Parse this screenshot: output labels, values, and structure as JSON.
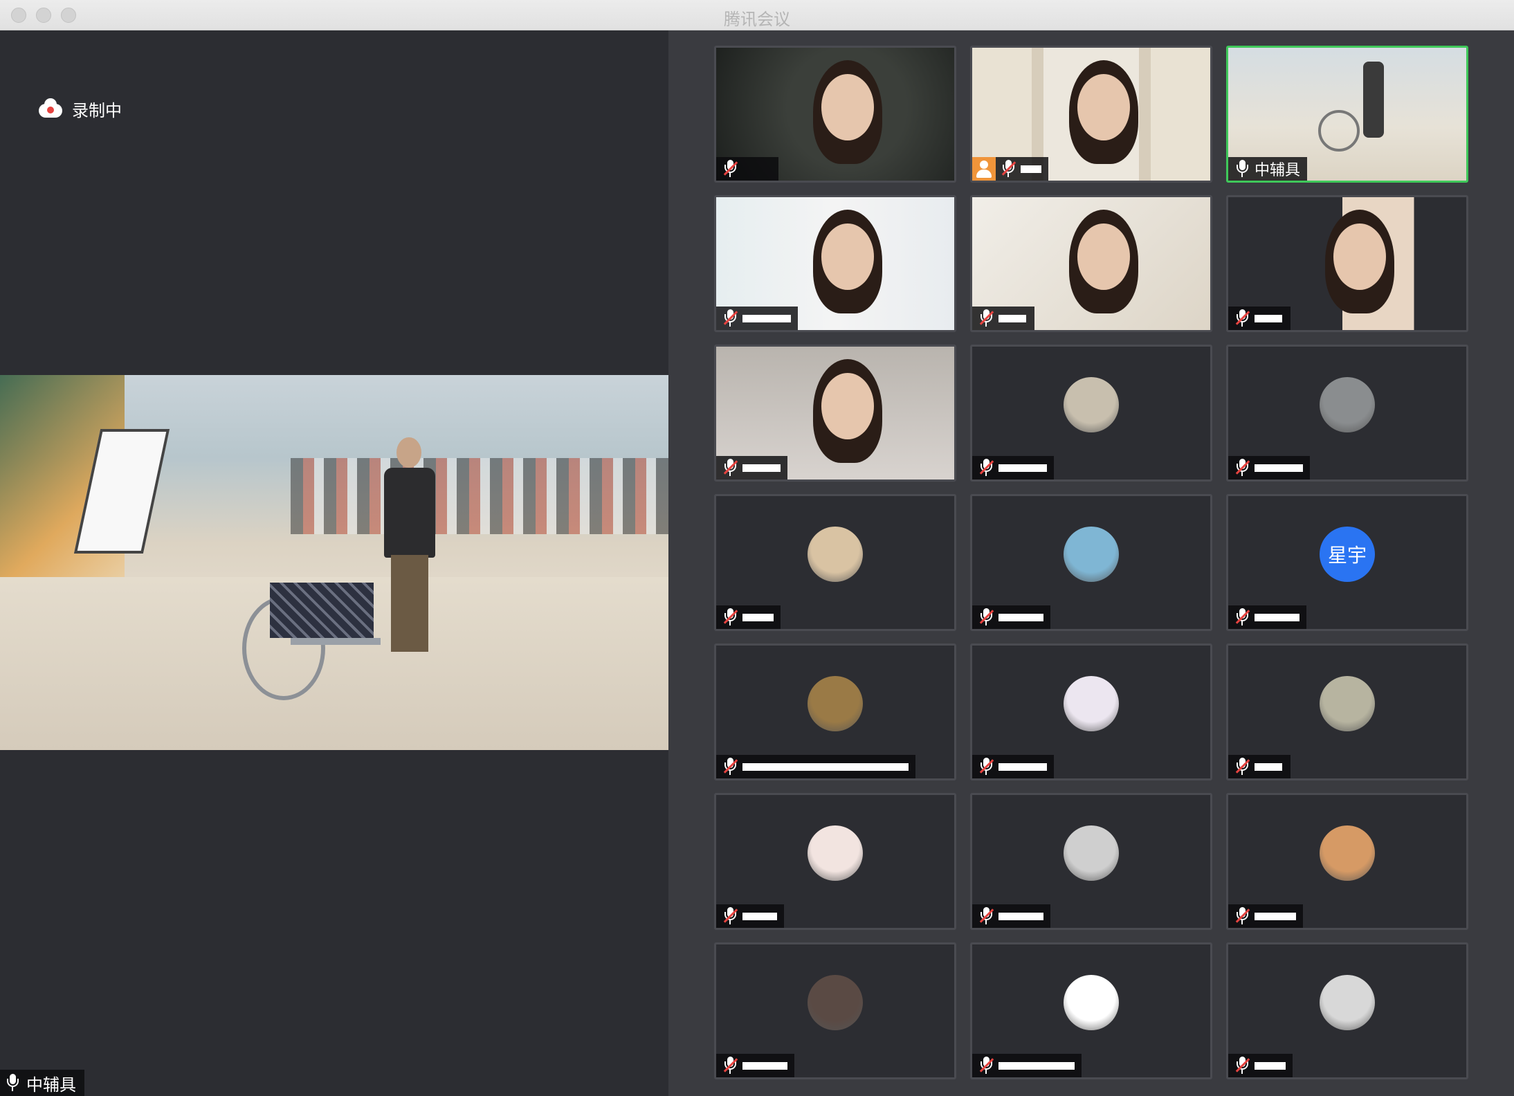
{
  "window": {
    "title": "腾讯会议"
  },
  "recording": {
    "label": "录制中"
  },
  "main_speaker": {
    "name": "中辅具"
  },
  "tiles": [
    {
      "kind": "video",
      "muted": true,
      "name": "",
      "redact": 0
    },
    {
      "kind": "video",
      "muted": true,
      "name": "",
      "redact": 30,
      "host": true
    },
    {
      "kind": "video",
      "muted": false,
      "name": "中辅具",
      "active": true
    },
    {
      "kind": "video",
      "muted": true,
      "name": "",
      "redact": 70
    },
    {
      "kind": "video",
      "muted": true,
      "name": "",
      "redact": 40
    },
    {
      "kind": "video",
      "muted": true,
      "name": "",
      "redact": 40
    },
    {
      "kind": "video",
      "muted": true,
      "name": "",
      "redact": 55
    },
    {
      "kind": "avatar",
      "muted": true,
      "name": "",
      "redact": 70,
      "avatar_color": "#c8bfae"
    },
    {
      "kind": "avatar",
      "muted": true,
      "name": "",
      "redact": 70,
      "avatar_color": "#8a8d8f"
    },
    {
      "kind": "avatar",
      "muted": true,
      "name": "",
      "redact": 45,
      "avatar_color": "#d9c3a3"
    },
    {
      "kind": "avatar",
      "muted": true,
      "name": "",
      "redact": 65,
      "avatar_color": "#7fb6d4"
    },
    {
      "kind": "avatar",
      "muted": true,
      "name": "",
      "redact": 65,
      "avatar_text": "星宇"
    },
    {
      "kind": "avatar",
      "muted": true,
      "name": "",
      "redact": 240,
      "avatar_color": "#9a7a46"
    },
    {
      "kind": "avatar",
      "muted": true,
      "name": "",
      "redact": 70,
      "avatar_color": "#ece6f0"
    },
    {
      "kind": "avatar",
      "muted": true,
      "name": "",
      "redact": 40,
      "avatar_color": "#b7b4a0"
    },
    {
      "kind": "avatar",
      "muted": true,
      "name": "",
      "redact": 50,
      "avatar_color": "#f2e4e0"
    },
    {
      "kind": "avatar",
      "muted": true,
      "name": "",
      "redact": 65,
      "avatar_color": "#cfcfcf"
    },
    {
      "kind": "avatar",
      "muted": true,
      "name": "",
      "redact": 60,
      "avatar_color": "#d69a65"
    },
    {
      "kind": "avatar",
      "muted": true,
      "name": "",
      "redact": 65,
      "avatar_color": "#5a4a44"
    },
    {
      "kind": "avatar",
      "muted": true,
      "name": "",
      "redact": 110,
      "avatar_color": "#ffffff"
    },
    {
      "kind": "avatar",
      "muted": true,
      "name": "",
      "redact": 45,
      "avatar_color": "#d8d8d8"
    }
  ],
  "colors": {
    "active_border": "#3fc85a",
    "muted_red": "#e64340",
    "avatar_blue": "#2a74f2",
    "host_orange": "#f0953a"
  }
}
